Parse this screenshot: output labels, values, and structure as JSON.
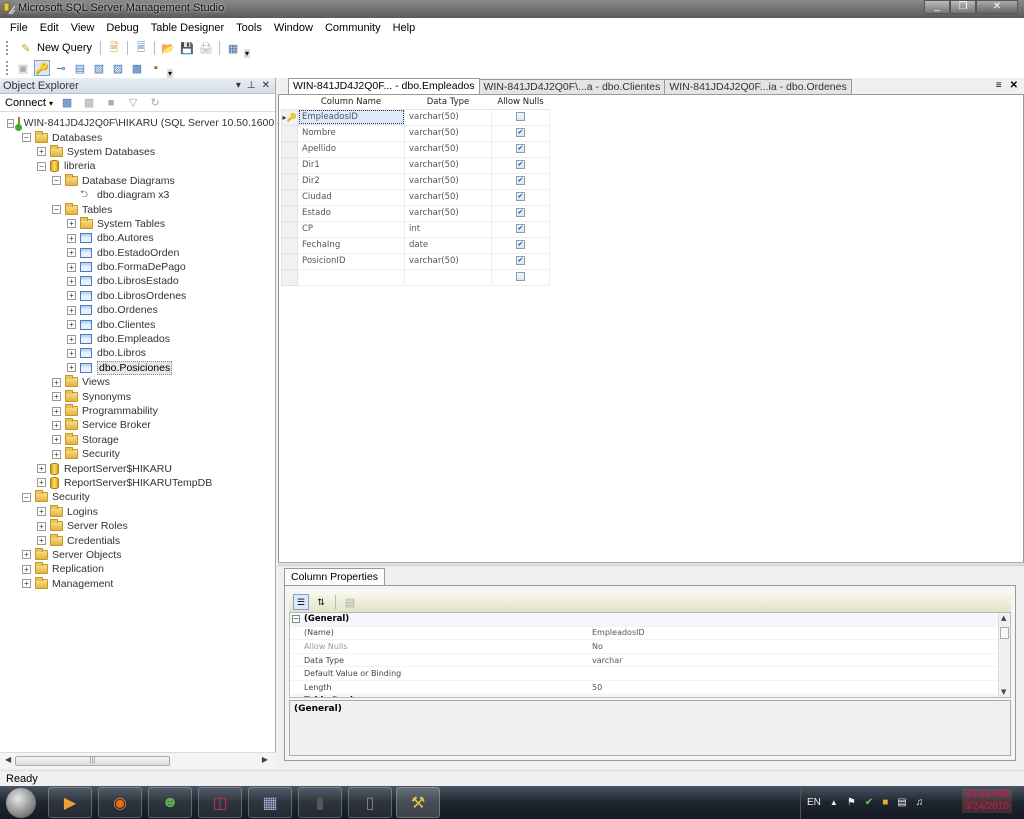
{
  "window": {
    "title": "Microsoft SQL Server Management Studio",
    "controls": [
      "minimize",
      "restore",
      "close"
    ]
  },
  "menu": [
    "File",
    "Edit",
    "View",
    "Debug",
    "Table Designer",
    "Tools",
    "Window",
    "Community",
    "Help"
  ],
  "toolbar": {
    "new_query_label": "New Query"
  },
  "object_explorer": {
    "title": "Object Explorer",
    "connect_label": "Connect",
    "tree": [
      {
        "label": "WIN-841JD4J2Q0F\\HIKARU (SQL Server 10.50.1600 -",
        "level": 0,
        "exp": "-",
        "icon": "server"
      },
      {
        "label": "Databases",
        "level": 1,
        "exp": "-",
        "icon": "folder"
      },
      {
        "label": "System Databases",
        "level": 2,
        "exp": "+",
        "icon": "folder"
      },
      {
        "label": "libreria",
        "level": 2,
        "exp": "-",
        "icon": "db"
      },
      {
        "label": "Database Diagrams",
        "level": 3,
        "exp": "-",
        "icon": "folder"
      },
      {
        "label": "dbo.diagram x3",
        "level": 4,
        "exp": "",
        "icon": "diagram"
      },
      {
        "label": "Tables",
        "level": 3,
        "exp": "-",
        "icon": "folder"
      },
      {
        "label": "System Tables",
        "level": 4,
        "exp": "+",
        "icon": "folder"
      },
      {
        "label": "dbo.Autores",
        "level": 4,
        "exp": "+",
        "icon": "table"
      },
      {
        "label": "dbo.EstadoOrden",
        "level": 4,
        "exp": "+",
        "icon": "table"
      },
      {
        "label": "dbo.FormaDePago",
        "level": 4,
        "exp": "+",
        "icon": "table"
      },
      {
        "label": "dbo.LibrosEstado",
        "level": 4,
        "exp": "+",
        "icon": "table"
      },
      {
        "label": "dbo.LibrosOrdenes",
        "level": 4,
        "exp": "+",
        "icon": "table"
      },
      {
        "label": "dbo.Ordenes",
        "level": 4,
        "exp": "+",
        "icon": "table"
      },
      {
        "label": "dbo.Clientes",
        "level": 4,
        "exp": "+",
        "icon": "table"
      },
      {
        "label": "dbo.Empleados",
        "level": 4,
        "exp": "+",
        "icon": "table"
      },
      {
        "label": "dbo.Libros",
        "level": 4,
        "exp": "+",
        "icon": "table"
      },
      {
        "label": "dbo.Posiciones",
        "level": 4,
        "exp": "+",
        "icon": "table",
        "selected": true
      },
      {
        "label": "Views",
        "level": 3,
        "exp": "+",
        "icon": "folder"
      },
      {
        "label": "Synonyms",
        "level": 3,
        "exp": "+",
        "icon": "folder"
      },
      {
        "label": "Programmability",
        "level": 3,
        "exp": "+",
        "icon": "folder"
      },
      {
        "label": "Service Broker",
        "level": 3,
        "exp": "+",
        "icon": "folder"
      },
      {
        "label": "Storage",
        "level": 3,
        "exp": "+",
        "icon": "folder"
      },
      {
        "label": "Security",
        "level": 3,
        "exp": "+",
        "icon": "folder"
      },
      {
        "label": "ReportServer$HIKARU",
        "level": 2,
        "exp": "+",
        "icon": "db"
      },
      {
        "label": "ReportServer$HIKARUTempDB",
        "level": 2,
        "exp": "+",
        "icon": "db"
      },
      {
        "label": "Security",
        "level": 1,
        "exp": "-",
        "icon": "folder"
      },
      {
        "label": "Logins",
        "level": 2,
        "exp": "+",
        "icon": "folder"
      },
      {
        "label": "Server Roles",
        "level": 2,
        "exp": "+",
        "icon": "folder"
      },
      {
        "label": "Credentials",
        "level": 2,
        "exp": "+",
        "icon": "folder"
      },
      {
        "label": "Server Objects",
        "level": 1,
        "exp": "+",
        "icon": "folder"
      },
      {
        "label": "Replication",
        "level": 1,
        "exp": "+",
        "icon": "folder"
      },
      {
        "label": "Management",
        "level": 1,
        "exp": "+",
        "icon": "folder"
      }
    ]
  },
  "tabs": [
    {
      "label": "WIN-841JD4J2Q0F... - dbo.Empleados",
      "active": true
    },
    {
      "label": "WIN-841JD4J2Q0F\\...a - dbo.Clientes",
      "active": false
    },
    {
      "label": "WIN-841JD4J2Q0F...ia - dbo.Ordenes",
      "active": false
    }
  ],
  "designer": {
    "headers": {
      "name": "Column Name",
      "type": "Data Type",
      "nulls": "Allow Nulls"
    },
    "rows": [
      {
        "name": "EmpleadosID",
        "type": "varchar(50)",
        "allow_nulls": false,
        "primary_key": true,
        "current": true
      },
      {
        "name": "Nombre",
        "type": "varchar(50)",
        "allow_nulls": true
      },
      {
        "name": "Apellido",
        "type": "varchar(50)",
        "allow_nulls": true
      },
      {
        "name": "Dir1",
        "type": "varchar(50)",
        "allow_nulls": true
      },
      {
        "name": "Dir2",
        "type": "varchar(50)",
        "allow_nulls": true
      },
      {
        "name": "Ciudad",
        "type": "varchar(50)",
        "allow_nulls": true
      },
      {
        "name": "Estado",
        "type": "varchar(50)",
        "allow_nulls": true
      },
      {
        "name": "CP",
        "type": "int",
        "allow_nulls": true
      },
      {
        "name": "FechaIng",
        "type": "date",
        "allow_nulls": true
      },
      {
        "name": "PosicionID",
        "type": "varchar(50)",
        "allow_nulls": true
      },
      {
        "name": "",
        "type": "",
        "allow_nulls": false
      }
    ]
  },
  "column_properties": {
    "tab_label": "Column Properties",
    "category": "(General)",
    "rows": [
      {
        "key": "(Name)",
        "value": "EmpleadosID",
        "dim": false
      },
      {
        "key": "Allow Nulls",
        "value": "No",
        "dim": true
      },
      {
        "key": "Data Type",
        "value": "varchar",
        "dim": false
      },
      {
        "key": "Default Value or Binding",
        "value": "",
        "dim": false
      },
      {
        "key": "Length",
        "value": "50",
        "dim": false
      }
    ],
    "next_category": "Table Designer",
    "description_title": "(General)"
  },
  "status": {
    "text": "Ready"
  },
  "taskbar": {
    "apps": [
      "windows-media-player",
      "firefox",
      "messenger",
      "access",
      "sql-table-app",
      "media-device",
      "blank-document",
      "sql-server-management-studio"
    ],
    "language": "EN",
    "time": "10:24 PM",
    "date": "3/24/2010"
  }
}
